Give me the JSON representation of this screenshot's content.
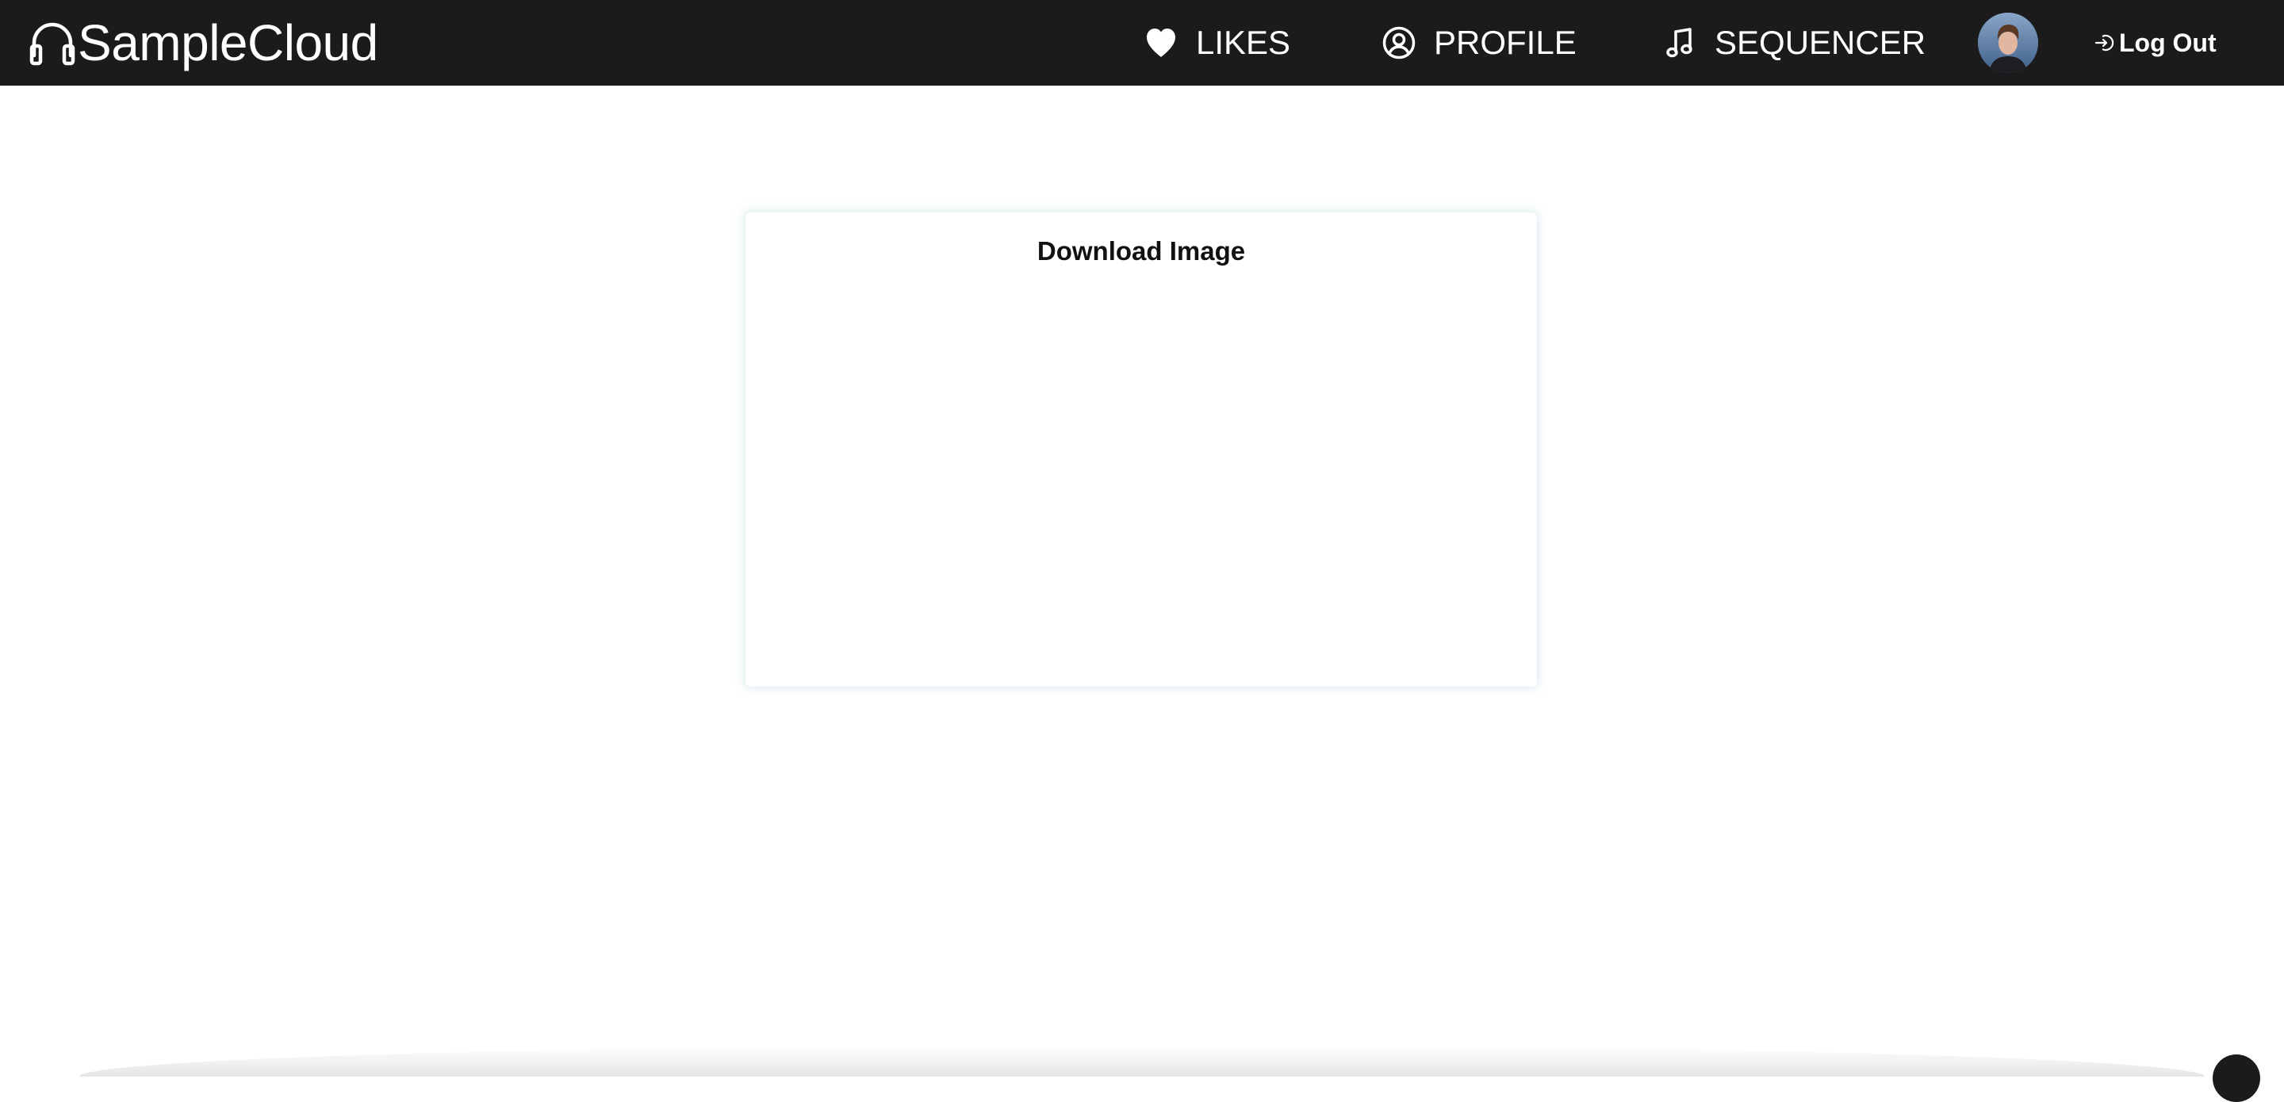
{
  "navbar": {
    "brand": {
      "name": "SampleCloud",
      "icon": "headphones-icon"
    },
    "links": [
      {
        "label": "LIKES",
        "icon": "heart-icon"
      },
      {
        "label": "PROFILE",
        "icon": "user-circle-icon"
      },
      {
        "label": "SEQUENCER",
        "icon": "music-note-icon"
      }
    ],
    "avatar": {
      "icon": "user-avatar"
    },
    "logout": {
      "label": "Log Out",
      "icon": "logout-icon"
    }
  },
  "main": {
    "card": {
      "title": "Download Image"
    }
  },
  "colors": {
    "navbar_bg": "#1c1b1c",
    "nav_text": "#ffffff",
    "page_bg": "#ffffff",
    "card_shadow": "#c8e2e8"
  }
}
